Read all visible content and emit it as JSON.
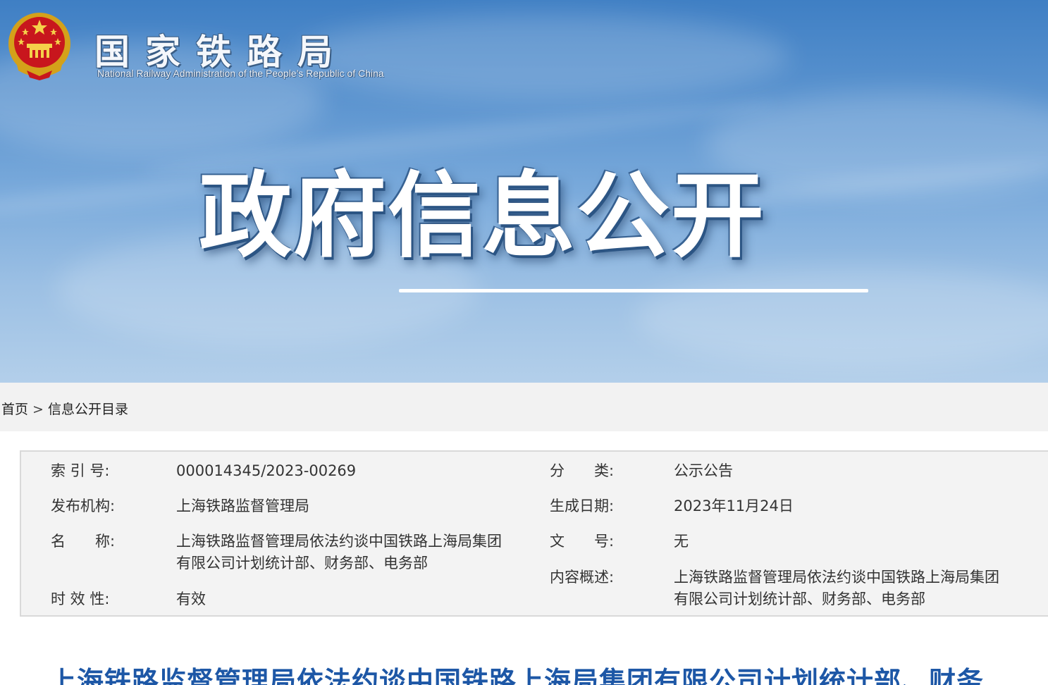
{
  "header": {
    "logo_cn": "国家铁路局",
    "logo_en": "National Railway Administration of the People's Republic of China",
    "banner_title": "政府信息公开"
  },
  "breadcrumb": {
    "home": "首页",
    "separator": ">",
    "current": "信息公开目录"
  },
  "meta": {
    "index_label": "索 引 号:",
    "index_value": "000014345/2023-00269",
    "category_label": "分　　类:",
    "category_value": "公示公告",
    "publisher_label": "发布机构:",
    "publisher_value": "上海铁路监督管理局",
    "date_label": "生成日期:",
    "date_value": "2023年11月24日",
    "name_label": "名　　称:",
    "name_value_line1": "上海铁路监督管理局依法约谈中国铁路上海局集团",
    "name_value_line2": "有限公司计划统计部、财务部、电务部",
    "docno_label": "文　　号:",
    "docno_value": "无",
    "summary_label": "内容概述:",
    "summary_value_line1": "上海铁路监督管理局依法约谈中国铁路上海局集团",
    "summary_value_line2": "有限公司计划统计部、财务部、电务部",
    "validity_label": "时 效 性:",
    "validity_value": "有效"
  },
  "article": {
    "title": "上海铁路监督管理局依法约谈中国铁路上海局集团有限公司计划统计部、财务"
  },
  "colors": {
    "title_blue": "#1d57a6",
    "banner_sky": "#5a93cf",
    "crumb_bg": "#f2f2f2",
    "meta_bg": "#f3f3f3"
  }
}
